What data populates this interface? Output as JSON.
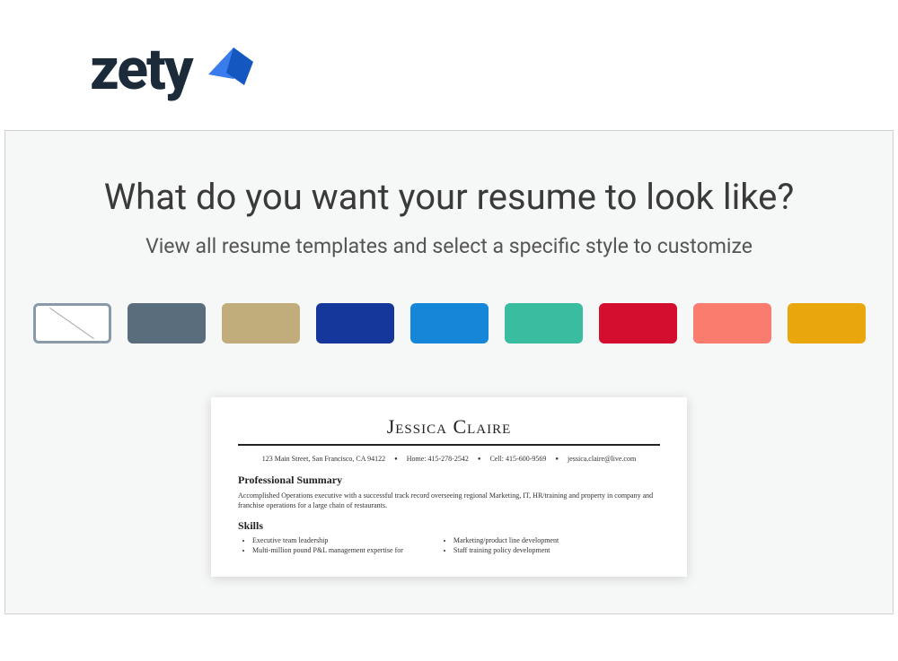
{
  "brand": {
    "name": "zety"
  },
  "heading": "What do you want your resume to look like?",
  "subheading": "View all resume templates and select a specific style to customize",
  "colors": [
    {
      "name": "none",
      "value": "#ffffff",
      "selected": true
    },
    {
      "name": "slate",
      "value": "#5a6d7c",
      "selected": false
    },
    {
      "name": "tan",
      "value": "#c1ad7c",
      "selected": false
    },
    {
      "name": "navy",
      "value": "#15379b",
      "selected": false
    },
    {
      "name": "blue",
      "value": "#1586d8",
      "selected": false
    },
    {
      "name": "teal",
      "value": "#39bca0",
      "selected": false
    },
    {
      "name": "red",
      "value": "#d40e2f",
      "selected": false
    },
    {
      "name": "coral",
      "value": "#fa7c6f",
      "selected": false
    },
    {
      "name": "amber",
      "value": "#eaa60d",
      "selected": false
    }
  ],
  "template": {
    "name": "Jessica Claire",
    "contact": {
      "address": "123 Main Street, San Francisco, CA 94122",
      "home": "Home: 415-278-2542",
      "cell": "Cell: 415-600-9569",
      "email": "jessica.claire@live.com"
    },
    "sections": {
      "summary_title": "Professional Summary",
      "summary_text": "Accomplished Operations executive with a successful track record overseeing regional Marketing, IT, HR/training and property in company and franchise operations for a large chain of restaurants.",
      "skills_title": "Skills",
      "skills_col1": [
        "Executive team leadership",
        "Multi-million pound P&L management expertise for"
      ],
      "skills_col2": [
        "Marketing/product line development",
        "Staff training policy development"
      ]
    }
  }
}
